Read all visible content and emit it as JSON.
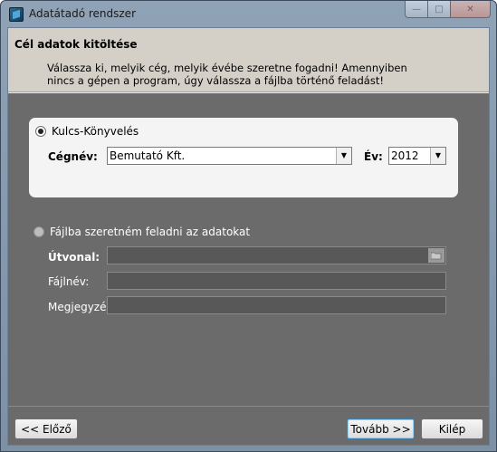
{
  "window": {
    "title": "Adatátadó rendszer"
  },
  "header": {
    "title": "Cél adatok kitöltése",
    "description": "Válassza ki, melyik cég, melyik évébe szeretne fogadni! Amennyiben nincs a gépen a program, úgy válassza a fájlba történő feladást!"
  },
  "option_kulcs": {
    "label": "Kulcs-Könyvelés",
    "checked": true,
    "company_label": "Cégnév:",
    "company_value": "Bemutató Kft.",
    "year_label": "Év:",
    "year_value": "2012"
  },
  "option_file": {
    "label": "Fájlba szeretném feladni az adatokat",
    "checked": false,
    "path_label": "Útvonal:",
    "filename_label": "Fájlnév:",
    "comment_label": "Megjegyzés:"
  },
  "footer": {
    "prev_label": "<< Előző",
    "next_label": "Tovább >>",
    "exit_label": "Kilép"
  },
  "colors": {
    "panel": "#f4f4f4",
    "overlay": "#6b6b6b",
    "header": "#d4d0c8"
  }
}
